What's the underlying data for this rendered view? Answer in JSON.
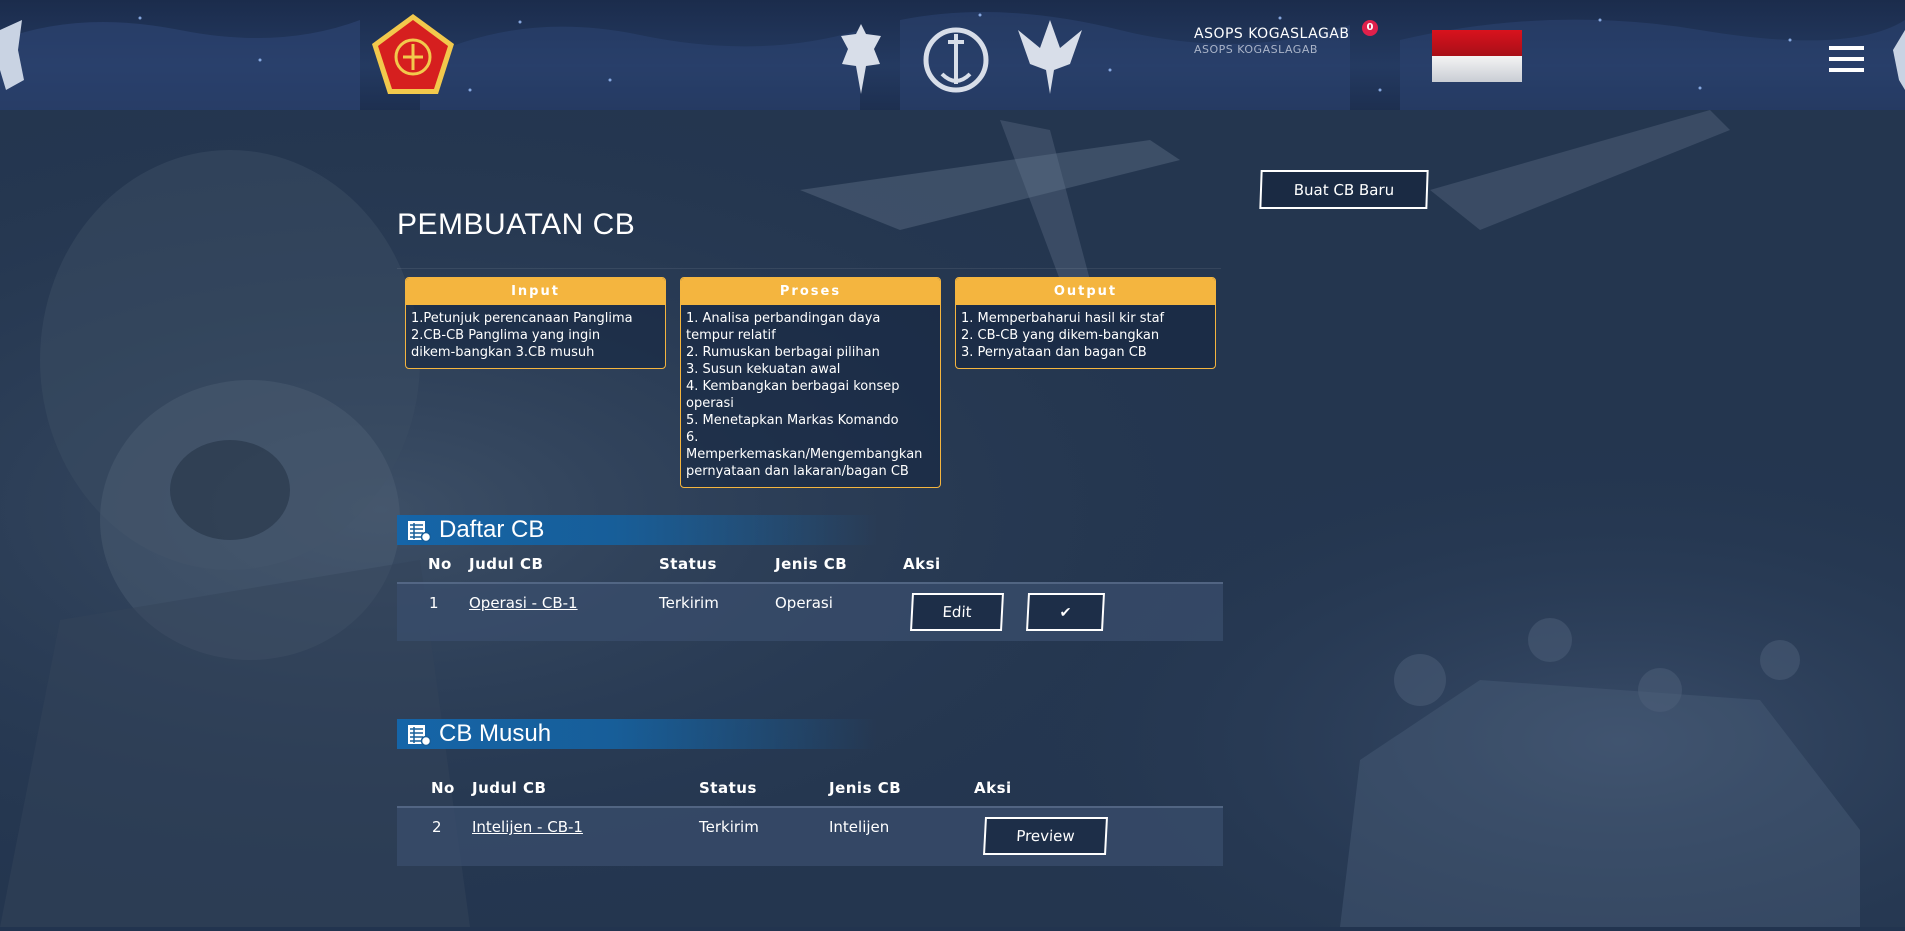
{
  "header": {
    "user_name": "ASOPS KOGASLAGAB",
    "user_sub": "ASOPS KOGASLAGAB",
    "notification_count": "0"
  },
  "actions": {
    "create_label": "Buat CB Baru"
  },
  "page": {
    "title": "PEMBUATAN CB"
  },
  "steps": [
    {
      "title": "Input",
      "lines": [
        "1.Petunjuk perencanaan Panglima",
        "2.CB-CB Panglima yang ingin",
        "dikem-bangkan 3.CB musuh"
      ]
    },
    {
      "title": "Proses",
      "lines": [
        "1. Analisa perbandingan daya",
        "tempur relatif",
        "2. Rumuskan berbagai pilihan",
        "3. Susun kekuatan awal",
        "4. Kembangkan berbagai konsep",
        "operasi",
        "5. Menetapkan Markas Komando",
        "6.",
        "Memperkemaskan/Mengembangkan",
        "pernyataan dan lakaran/bagan CB"
      ]
    },
    {
      "title": "Output",
      "lines": [
        "1. Memperbaharui hasil kir staf",
        "2. CB-CB yang dikem-bangkan",
        "3. Pernyataan dan bagan CB"
      ]
    }
  ],
  "daftar": {
    "title": "Daftar CB",
    "columns": [
      "No",
      "Judul CB",
      "Status",
      "Jenis CB",
      "Aksi"
    ],
    "rows": [
      {
        "no": "1",
        "judul": "Operasi - CB-1",
        "status": "Terkirim",
        "jenis": "Operasi",
        "edit_label": "Edit",
        "confirm_icon": "✔"
      }
    ]
  },
  "musuh": {
    "title": "CB Musuh",
    "columns": [
      "No",
      "Judul CB",
      "Status",
      "Jenis CB",
      "Aksi"
    ],
    "rows": [
      {
        "no": "2",
        "judul": "Intelijen - CB-1",
        "status": "Terkirim",
        "jenis": "Intelijen",
        "preview_label": "Preview"
      }
    ]
  },
  "colors": {
    "accent": "#f4b53f",
    "section": "#1565a8",
    "badge": "#e0204b",
    "background": "#22344f"
  },
  "icons": [
    "tni-emblem-icon",
    "army-emblem-icon",
    "navy-emblem-icon",
    "airforce-emblem-icon",
    "indonesia-flag-icon",
    "hamburger-menu-icon",
    "table-icon",
    "check-icon"
  ]
}
